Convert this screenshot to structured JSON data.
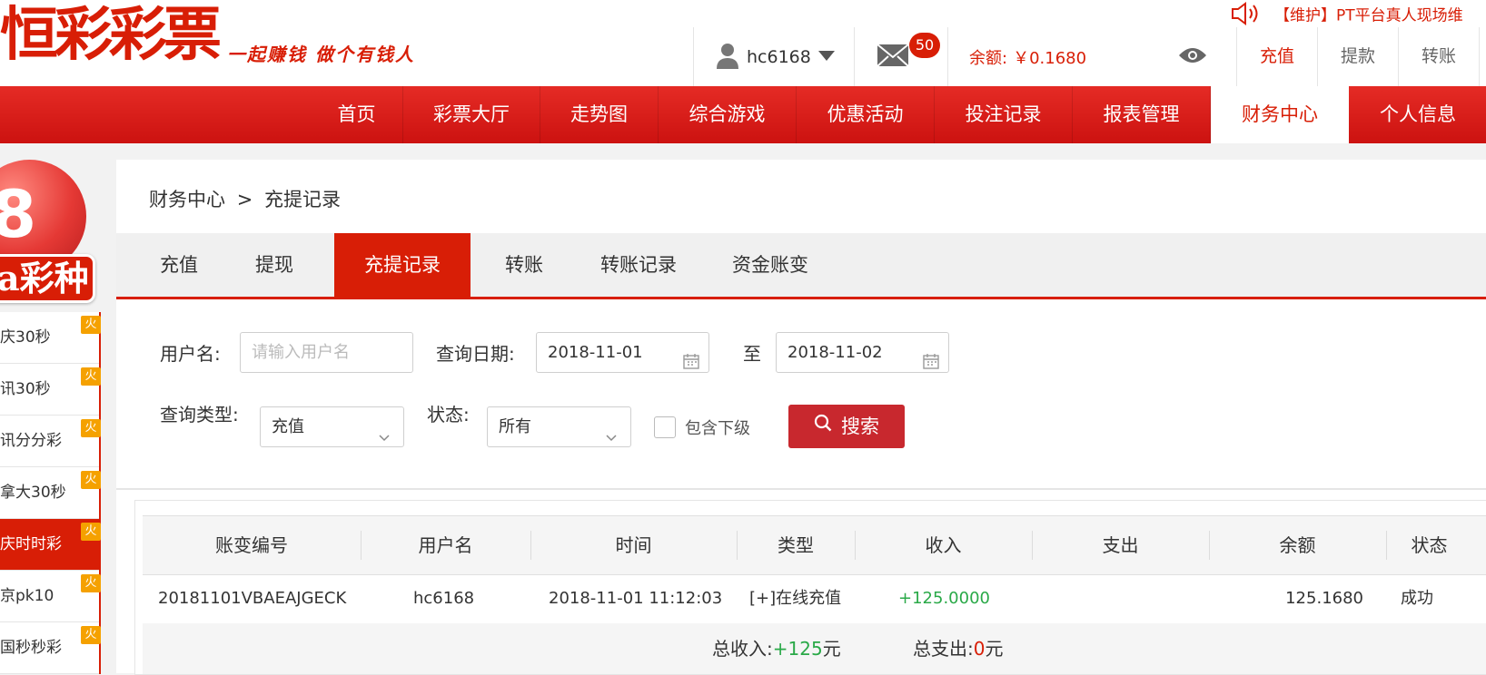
{
  "header": {
    "logo": "恒彩彩票",
    "slogan": "一起赚钱 做个有钱人",
    "notice": "【维护】PT平台真人现场维",
    "username": "hc6168",
    "mail_count": "50",
    "balance_label": "余额:",
    "balance_value": "￥0.1680",
    "links": [
      "充值",
      "提款",
      "转账"
    ]
  },
  "nav": {
    "items": [
      "首页",
      "彩票大厅",
      "走势图",
      "综合游戏",
      "优惠活动",
      "投注记录",
      "报表管理",
      "财务中心",
      "个人信息"
    ],
    "active": "财务中心"
  },
  "sidebar": {
    "badge_num": "8",
    "badge_text": "a彩种",
    "fire": "火",
    "items": [
      "庆30秒",
      "讯30秒",
      "讯分分彩",
      "拿大30秒",
      "庆时时彩",
      "京pk10",
      "国秒秒彩"
    ],
    "active": "庆时时彩"
  },
  "breadcrumb": {
    "root": "财务中心",
    "sep": ">",
    "current": "充提记录"
  },
  "tabs": [
    "充值",
    "提现",
    "充提记录",
    "转账",
    "转账记录",
    "资金账变"
  ],
  "active_tab": "充提记录",
  "filters": {
    "username_label": "用户名:",
    "username_placeholder": "请输入用户名",
    "date_label": "查询日期:",
    "date_from": "2018-11-01",
    "date_to_label": "至",
    "date_to": "2018-11-02",
    "type_label": "查询类型:",
    "type_value": "充值",
    "status_label": "状态:",
    "status_value": "所有",
    "include_sub_label": "包含下级",
    "include_sub_checked": false,
    "search_label": "搜索"
  },
  "table": {
    "columns": [
      "账变编号",
      "用户名",
      "时间",
      "类型",
      "收入",
      "支出",
      "余额",
      "状态"
    ],
    "rows": [
      {
        "id": "20181101VBAEAJGECK",
        "user": "hc6168",
        "time": "2018-11-01 11:12:03",
        "type": "[+]在线充值",
        "income": "+125.0000",
        "expense": "",
        "balance": "125.1680",
        "status": "成功"
      }
    ],
    "footer": {
      "income_label": "总收入:",
      "income_value": "+125",
      "income_unit": "元",
      "expense_label": "总支出:",
      "expense_value": "0",
      "expense_unit": "元"
    }
  },
  "colors": {
    "brand_red": "#d81e06",
    "income_green": "#2aa948",
    "search_button": "#c8282e"
  }
}
